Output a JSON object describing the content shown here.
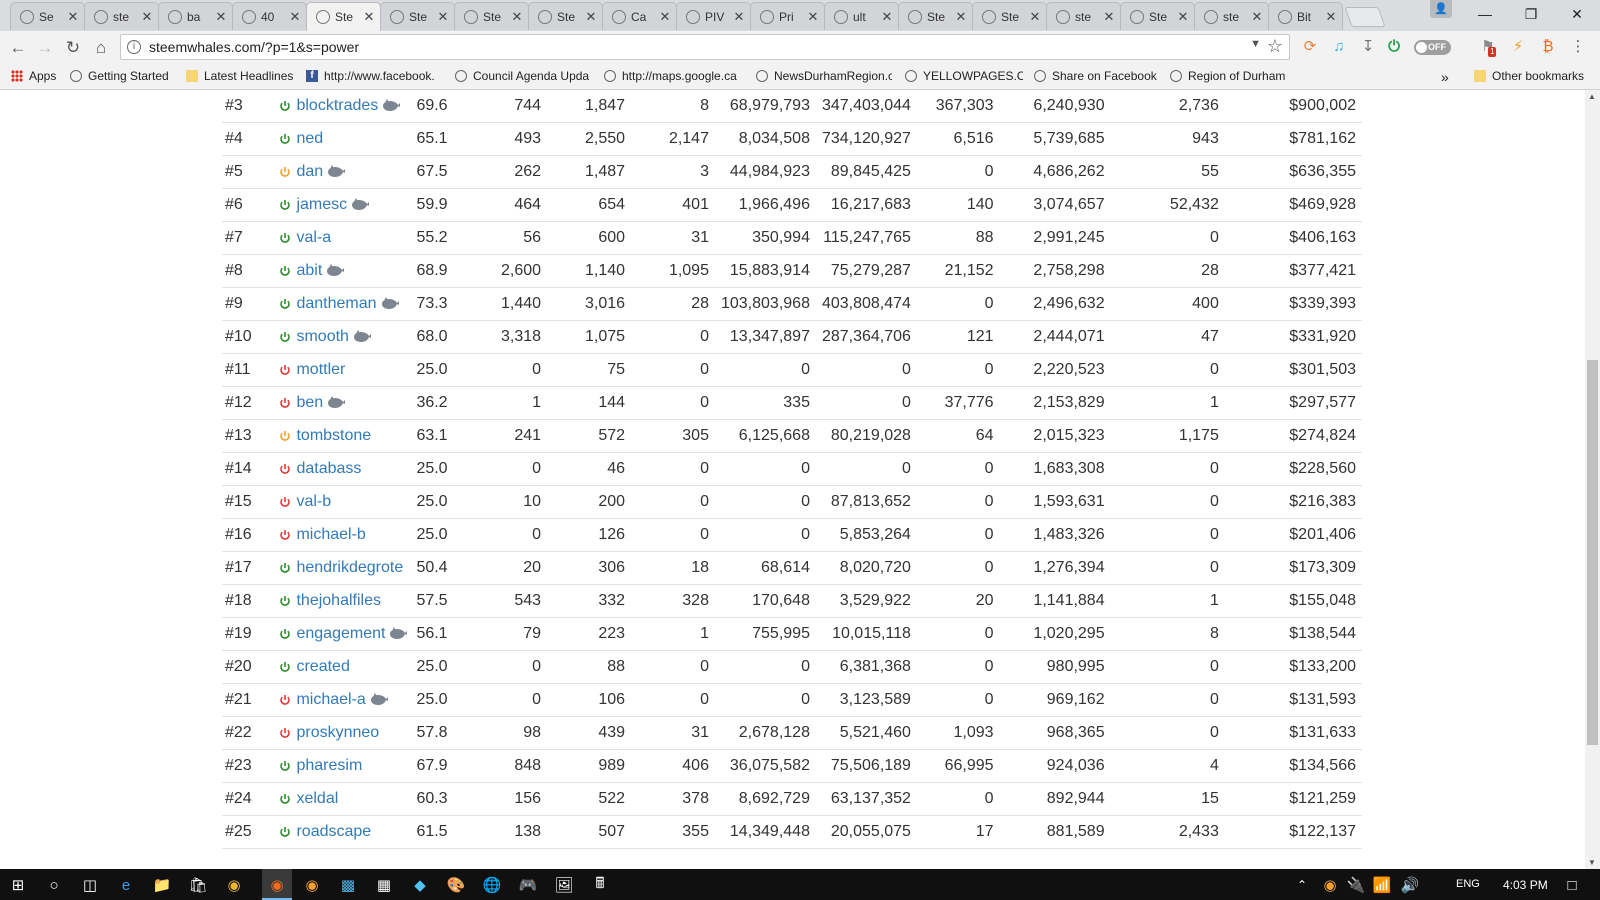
{
  "browser": {
    "tabs": [
      {
        "title": "Se",
        "active": false
      },
      {
        "title": "ste",
        "active": false
      },
      {
        "title": "ba",
        "active": false
      },
      {
        "title": "40",
        "active": false
      },
      {
        "title": "Ste",
        "active": true
      },
      {
        "title": "Ste",
        "active": false
      },
      {
        "title": "Ste",
        "active": false
      },
      {
        "title": "Ste",
        "active": false
      },
      {
        "title": "Ca",
        "active": false
      },
      {
        "title": "PIV",
        "active": false
      },
      {
        "title": "Pri",
        "active": false
      },
      {
        "title": "ult",
        "active": false
      },
      {
        "title": "Ste",
        "active": false
      },
      {
        "title": "Ste",
        "active": false
      },
      {
        "title": "ste",
        "active": false
      },
      {
        "title": "Ste",
        "active": false
      },
      {
        "title": "ste",
        "active": false
      },
      {
        "title": "Bit",
        "active": false
      }
    ],
    "tab_close_glyph": "✕",
    "address": "steemwhales.com/?p=1&s=power",
    "toggle_label": "OFF",
    "badge_count": "1"
  },
  "bookmarks": {
    "items": [
      {
        "label": "Apps",
        "icon": "apps-grid-icon"
      },
      {
        "label": "Getting Started",
        "icon": "steem-icon"
      },
      {
        "label": "Latest Headlines",
        "icon": "folder-icon"
      },
      {
        "label": "http://www.facebook.",
        "icon": "facebook-icon"
      },
      {
        "label": "Council Agenda Upda",
        "icon": "steem-icon"
      },
      {
        "label": "http://maps.google.ca",
        "icon": "steem-icon"
      },
      {
        "label": "NewsDurhamRegion.c",
        "icon": "steem-icon"
      },
      {
        "label": "YELLOWPAGES.CA",
        "icon": "steem-icon"
      },
      {
        "label": "Share on Facebook",
        "icon": "steem-icon"
      },
      {
        "label": "Region of Durham",
        "icon": "steem-icon"
      }
    ],
    "overflow_glyph": "»",
    "other_label": "Other bookmarks"
  },
  "colors": {
    "online": "#2e8b2e",
    "idle": "#f0a030",
    "offline": "#e03a3a",
    "link": "#337ab7"
  },
  "rows": [
    {
      "rank": "#3",
      "name": "blocktrades",
      "status": "online",
      "whale": true,
      "rep": "69.6",
      "c1": "744",
      "c2": "1,847",
      "c3": "8",
      "c4": "68,979,793",
      "c5": "347,403,044",
      "c6": "367,303",
      "c7": "6,240,930",
      "c8": "2,736",
      "usd": "$900,002"
    },
    {
      "rank": "#4",
      "name": "ned",
      "status": "online",
      "whale": false,
      "rep": "65.1",
      "c1": "493",
      "c2": "2,550",
      "c3": "2,147",
      "c4": "8,034,508",
      "c5": "734,120,927",
      "c6": "6,516",
      "c7": "5,739,685",
      "c8": "943",
      "usd": "$781,162"
    },
    {
      "rank": "#5",
      "name": "dan",
      "status": "idle",
      "whale": true,
      "rep": "67.5",
      "c1": "262",
      "c2": "1,487",
      "c3": "3",
      "c4": "44,984,923",
      "c5": "89,845,425",
      "c6": "0",
      "c7": "4,686,262",
      "c8": "55",
      "usd": "$636,355"
    },
    {
      "rank": "#6",
      "name": "jamesc",
      "status": "online",
      "whale": true,
      "rep": "59.9",
      "c1": "464",
      "c2": "654",
      "c3": "401",
      "c4": "1,966,496",
      "c5": "16,217,683",
      "c6": "140",
      "c7": "3,074,657",
      "c8": "52,432",
      "usd": "$469,928"
    },
    {
      "rank": "#7",
      "name": "val-a",
      "status": "online",
      "whale": false,
      "rep": "55.2",
      "c1": "56",
      "c2": "600",
      "c3": "31",
      "c4": "350,994",
      "c5": "115,247,765",
      "c6": "88",
      "c7": "2,991,245",
      "c8": "0",
      "usd": "$406,163"
    },
    {
      "rank": "#8",
      "name": "abit",
      "status": "online",
      "whale": true,
      "rep": "68.9",
      "c1": "2,600",
      "c2": "1,140",
      "c3": "1,095",
      "c4": "15,883,914",
      "c5": "75,279,287",
      "c6": "21,152",
      "c7": "2,758,298",
      "c8": "28",
      "usd": "$377,421"
    },
    {
      "rank": "#9",
      "name": "dantheman",
      "status": "online",
      "whale": true,
      "rep": "73.3",
      "c1": "1,440",
      "c2": "3,016",
      "c3": "28",
      "c4": "103,803,968",
      "c5": "403,808,474",
      "c6": "0",
      "c7": "2,496,632",
      "c8": "400",
      "usd": "$339,393"
    },
    {
      "rank": "#10",
      "name": "smooth",
      "status": "online",
      "whale": true,
      "rep": "68.0",
      "c1": "3,318",
      "c2": "1,075",
      "c3": "0",
      "c4": "13,347,897",
      "c5": "287,364,706",
      "c6": "121",
      "c7": "2,444,071",
      "c8": "47",
      "usd": "$331,920"
    },
    {
      "rank": "#11",
      "name": "mottler",
      "status": "offline",
      "whale": false,
      "rep": "25.0",
      "c1": "0",
      "c2": "75",
      "c3": "0",
      "c4": "0",
      "c5": "0",
      "c6": "0",
      "c7": "2,220,523",
      "c8": "0",
      "usd": "$301,503"
    },
    {
      "rank": "#12",
      "name": "ben",
      "status": "offline",
      "whale": true,
      "rep": "36.2",
      "c1": "1",
      "c2": "144",
      "c3": "0",
      "c4": "335",
      "c5": "0",
      "c6": "37,776",
      "c7": "2,153,829",
      "c8": "1",
      "usd": "$297,577"
    },
    {
      "rank": "#13",
      "name": "tombstone",
      "status": "idle",
      "whale": false,
      "rep": "63.1",
      "c1": "241",
      "c2": "572",
      "c3": "305",
      "c4": "6,125,668",
      "c5": "80,219,028",
      "c6": "64",
      "c7": "2,015,323",
      "c8": "1,175",
      "usd": "$274,824"
    },
    {
      "rank": "#14",
      "name": "databass",
      "status": "offline",
      "whale": false,
      "rep": "25.0",
      "c1": "0",
      "c2": "46",
      "c3": "0",
      "c4": "0",
      "c5": "0",
      "c6": "0",
      "c7": "1,683,308",
      "c8": "0",
      "usd": "$228,560"
    },
    {
      "rank": "#15",
      "name": "val-b",
      "status": "offline",
      "whale": false,
      "rep": "25.0",
      "c1": "10",
      "c2": "200",
      "c3": "0",
      "c4": "0",
      "c5": "87,813,652",
      "c6": "0",
      "c7": "1,593,631",
      "c8": "0",
      "usd": "$216,383"
    },
    {
      "rank": "#16",
      "name": "michael-b",
      "status": "offline",
      "whale": false,
      "rep": "25.0",
      "c1": "0",
      "c2": "126",
      "c3": "0",
      "c4": "0",
      "c5": "5,853,264",
      "c6": "0",
      "c7": "1,483,326",
      "c8": "0",
      "usd": "$201,406"
    },
    {
      "rank": "#17",
      "name": "hendrikdegrote",
      "status": "online",
      "whale": false,
      "rep": "50.4",
      "c1": "20",
      "c2": "306",
      "c3": "18",
      "c4": "68,614",
      "c5": "8,020,720",
      "c6": "0",
      "c7": "1,276,394",
      "c8": "0",
      "usd": "$173,309"
    },
    {
      "rank": "#18",
      "name": "thejohalfiles",
      "status": "online",
      "whale": false,
      "rep": "57.5",
      "c1": "543",
      "c2": "332",
      "c3": "328",
      "c4": "170,648",
      "c5": "3,529,922",
      "c6": "20",
      "c7": "1,141,884",
      "c8": "1",
      "usd": "$155,048"
    },
    {
      "rank": "#19",
      "name": "engagement",
      "status": "online",
      "whale": true,
      "rep": "56.1",
      "c1": "79",
      "c2": "223",
      "c3": "1",
      "c4": "755,995",
      "c5": "10,015,118",
      "c6": "0",
      "c7": "1,020,295",
      "c8": "8",
      "usd": "$138,544"
    },
    {
      "rank": "#20",
      "name": "created",
      "status": "online",
      "whale": false,
      "rep": "25.0",
      "c1": "0",
      "c2": "88",
      "c3": "0",
      "c4": "0",
      "c5": "6,381,368",
      "c6": "0",
      "c7": "980,995",
      "c8": "0",
      "usd": "$133,200"
    },
    {
      "rank": "#21",
      "name": "michael-a",
      "status": "offline",
      "whale": true,
      "rep": "25.0",
      "c1": "0",
      "c2": "106",
      "c3": "0",
      "c4": "0",
      "c5": "3,123,589",
      "c6": "0",
      "c7": "969,162",
      "c8": "0",
      "usd": "$131,593"
    },
    {
      "rank": "#22",
      "name": "proskynneo",
      "status": "offline",
      "whale": false,
      "rep": "57.8",
      "c1": "98",
      "c2": "439",
      "c3": "31",
      "c4": "2,678,128",
      "c5": "5,521,460",
      "c6": "1,093",
      "c7": "968,365",
      "c8": "0",
      "usd": "$131,633"
    },
    {
      "rank": "#23",
      "name": "pharesim",
      "status": "online",
      "whale": false,
      "rep": "67.9",
      "c1": "848",
      "c2": "989",
      "c3": "406",
      "c4": "36,075,582",
      "c5": "75,506,189",
      "c6": "66,995",
      "c7": "924,036",
      "c8": "4",
      "usd": "$134,566"
    },
    {
      "rank": "#24",
      "name": "xeldal",
      "status": "online",
      "whale": false,
      "rep": "60.3",
      "c1": "156",
      "c2": "522",
      "c3": "378",
      "c4": "8,692,729",
      "c5": "63,137,352",
      "c6": "0",
      "c7": "892,944",
      "c8": "15",
      "usd": "$121,259"
    },
    {
      "rank": "#25",
      "name": "roadscape",
      "status": "online",
      "whale": false,
      "rep": "61.5",
      "c1": "138",
      "c2": "507",
      "c3": "355",
      "c4": "14,349,448",
      "c5": "20,055,075",
      "c6": "17",
      "c7": "881,589",
      "c8": "2,433",
      "usd": "$122,137"
    }
  ],
  "taskbar": {
    "lang": "ENG",
    "time": "4:03 PM"
  }
}
